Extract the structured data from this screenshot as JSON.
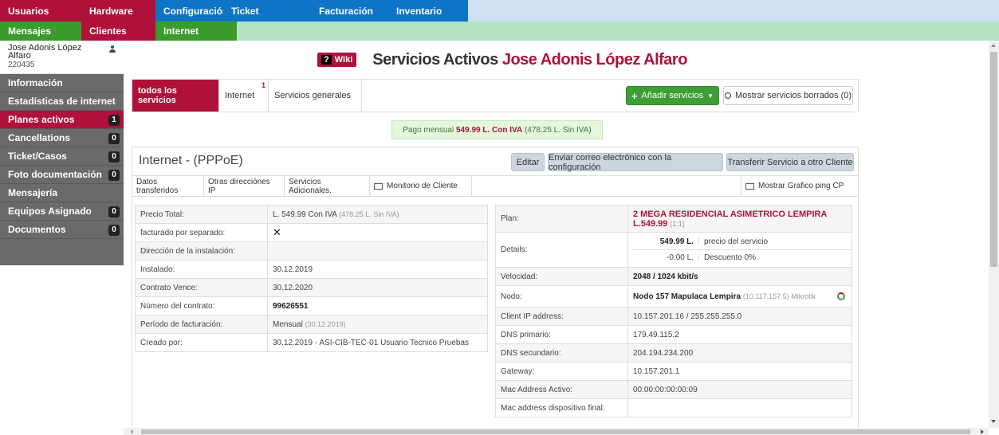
{
  "nav": {
    "row1": [
      "Usuarios",
      "Hardware",
      "Configuración",
      "Ticket",
      "Facturación",
      "Inventario"
    ],
    "row2": [
      "Mensajes",
      "Clientes",
      "Internet"
    ]
  },
  "sidebar": {
    "user_name": "Jose Adonis López Alfaro",
    "user_id": "220435",
    "items": [
      {
        "label": "Información",
        "badge": ""
      },
      {
        "label": "Estadísticas de internet",
        "badge": ""
      },
      {
        "label": "Planes activos",
        "badge": "1"
      },
      {
        "label": "Cancellations",
        "badge": "0"
      },
      {
        "label": "Ticket/Casos",
        "badge": "0"
      },
      {
        "label": "Foto documentación",
        "badge": "0"
      },
      {
        "label": "Mensajería",
        "badge": ""
      },
      {
        "label": "Equipos Asignado",
        "badge": "0"
      },
      {
        "label": "Documentos",
        "badge": "0"
      }
    ]
  },
  "header": {
    "wiki_q": "?",
    "wiki_label": "Wiki",
    "title_prefix": "Servicios Activos",
    "title_name": "Jose Adonis López Alfaro"
  },
  "tabs": {
    "all": "todos los servicios",
    "internet": "Internet",
    "internet_badge": "1",
    "general": "Servicios generales",
    "add_btn": "Añadir servicios",
    "show_deleted": "Mostrar servicios borrados (0)"
  },
  "pago": {
    "prefix": "Pago mensual",
    "amount": "549.99 L. Con IVA",
    "sin_iva": "(478.25 L. Sin IVA)"
  },
  "service": {
    "title": "Internet - (PPPoE)",
    "edit": "Editar",
    "email": "Enviar correo electrónico con la configuración",
    "transfer": "Transferir Servicio a otro Cliente",
    "subtabs": [
      "Datos transferidos",
      "Otras direcciónes IP",
      "Servicios Adicionales.",
      "Monitorio de Cliente"
    ],
    "ping": "Mostrar Grafico ping CP"
  },
  "left_table": {
    "precio_label": "Precio Total:",
    "precio_value": "L. 549.99 Con IVA",
    "precio_sin": "(478.25 L. Sin IVA)",
    "fact_label": "facturado por separado:",
    "fact_value": "✕",
    "dir_label": "Dirección de la instalación:",
    "dir_value": "",
    "inst_label": "Instalado:",
    "inst_value": "30.12.2019",
    "vence_label": "Contrato Vence:",
    "vence_value": "30.12.2020",
    "num_label": "Número del contrato:",
    "num_value": "99626551",
    "periodo_label": "Período de facturación:",
    "periodo_value": "Mensual",
    "periodo_date": "(30.12.2019)",
    "creado_label": "Creado por:",
    "creado_value": "30.12.2019 - ASI-CIB-TEC-01 Usuario Tecnico Pruebas"
  },
  "right_table": {
    "plan_label": "Plan:",
    "plan_name": "2 MEGA RESIDENCIAL ASIMETRICO LEMPIRA",
    "plan_price": "L.549.99",
    "plan_ratio": "(1:1)",
    "details_label": "Details:",
    "d1_amount": "549.99 L.",
    "d1_desc": "precio del servicio",
    "d2_amount": "-0.00 L.",
    "d2_desc": "Descuento 0%",
    "vel_label": "Velocidad:",
    "vel_value": "2048 / 1024 kbit/s",
    "nodo_label": "Nodo:",
    "nodo_value": "Nodo 157 Mapulaca Lempira",
    "nodo_extra": "(10.117.157.5) Mikrotik",
    "ip_label": "Client IP address:",
    "ip_value": "10.157.201.16 / 255.255.255.0",
    "dns1_label": "DNS primario:",
    "dns1_value": "179.49.115.2",
    "dns2_label": "DNS secundario:",
    "dns2_value": "204.194.234.200",
    "gw_label": "Gateway:",
    "gw_value": "10.157.201.1",
    "mac_label": "Mac Address Activo:",
    "mac_value": "00:00:00:00:00:09",
    "macf_label": "Mac address dispositivo final:",
    "macf_value": ""
  }
}
